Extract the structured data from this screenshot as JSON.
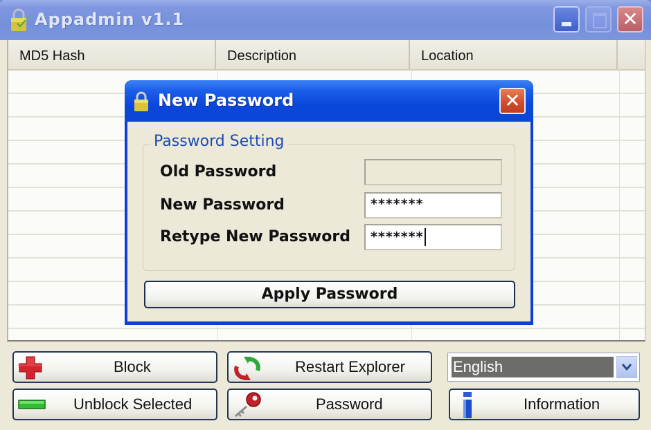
{
  "window": {
    "title": "Appadmin v1.1",
    "title_icon": "lock-icon",
    "controls": {
      "minimize": "minimize-icon",
      "maximize": "maximize-icon",
      "close": "close-icon",
      "close_glyph": "✕"
    }
  },
  "list": {
    "columns": [
      "MD5 Hash",
      "Description",
      "Location"
    ],
    "rows": []
  },
  "dialog": {
    "title": "New Password",
    "title_icon": "lock-icon",
    "close_glyph": "✕",
    "group_title": "Password Setting",
    "fields": [
      {
        "label": "Old Password",
        "value": "",
        "enabled": false
      },
      {
        "label": "New Password",
        "value": "*******",
        "enabled": true
      },
      {
        "label": "Retype New Password",
        "value": "*******",
        "enabled": true,
        "focused": true
      }
    ],
    "apply_label": "Apply Password"
  },
  "toolbar": {
    "block": {
      "label": "Block",
      "icon": "red-plus-icon"
    },
    "unblock": {
      "label": "Unblock Selected",
      "icon": "green-minus-icon"
    },
    "restart": {
      "label": "Restart Explorer",
      "icon": "refresh-arrows-icon"
    },
    "password": {
      "label": "Password",
      "icon": "key-icon"
    },
    "language": {
      "selected": "English"
    },
    "information": {
      "label": "Information",
      "icon": "info-icon"
    }
  },
  "colors": {
    "title_bar": "#7590db",
    "dialog_title_bar": "#0a47dc",
    "dialog_close": "#d24a2b",
    "window_close": "#b95f68",
    "group_title": "#1a4bb5",
    "face": "#ece9d8"
  }
}
